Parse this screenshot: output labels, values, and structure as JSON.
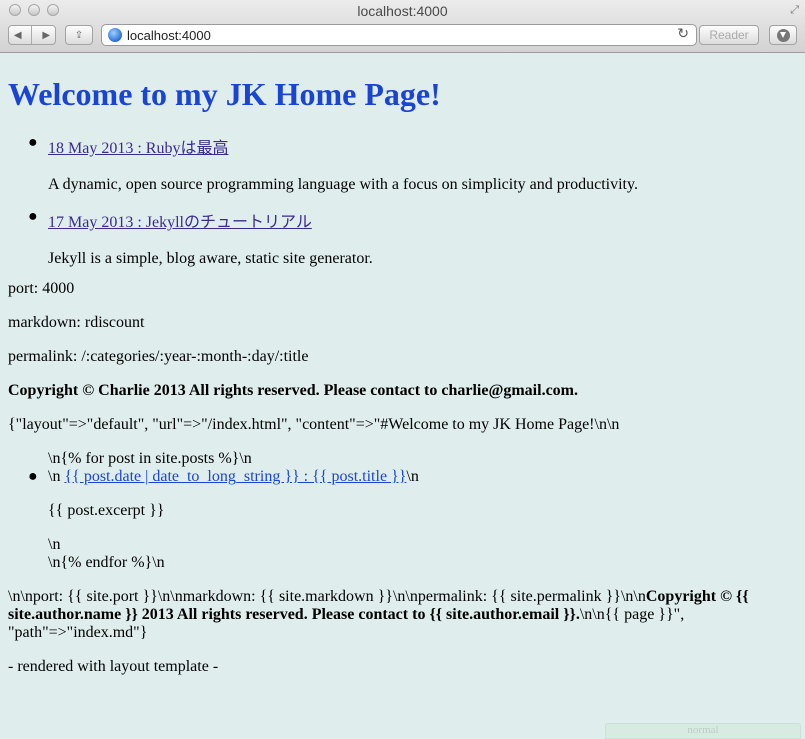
{
  "window": {
    "title": "localhost:4000",
    "url": "localhost:4000",
    "reader_label": "Reader"
  },
  "page": {
    "heading": "Welcome to my JK Home Page!",
    "posts": [
      {
        "link": "18 May 2013 : Rubyは最高",
        "excerpt": "A dynamic, open source programming language with a focus on simplicity and productivity."
      },
      {
        "link": "17 May 2013 : Jekyllのチュートリアル",
        "excerpt": "Jekyll is a simple, blog aware, static site generator."
      }
    ],
    "port_line": "port: 4000",
    "markdown_line": "markdown: rdiscount",
    "permalink_line": "permalink: /:categories/:year-:month-:day/:title",
    "copyright_line": "Copyright © Charlie 2013 All rights reserved. Please contact to charlie@gmail.com.",
    "raw_dump_start": "{\"layout\"=>\"default\", \"url\"=>\"/index.html\", \"content\"=>\"#Welcome to my JK Home Page!\\n\\n",
    "raw_for": "\\n{% for post in site.posts %}\\n",
    "raw_item_prefix": "\\n ",
    "raw_item_link": "{{ post.date | date_to_long_string }} : {{ post.title }}",
    "raw_item_suffix": "\\n",
    "raw_excerpt": "{{ post.excerpt }}",
    "raw_newline": "\\n",
    "raw_endfor": "\\n{% endfor %}\\n",
    "raw_tail_1": "\\n\\nport: {{ site.port }}\\n\\nmarkdown: {{ site.markdown }}\\n\\npermalink: {{ site.permalink }}\\n\\n",
    "raw_tail_bold_1": "Copyright © {{ site.author.name }} 2013 All rights reserved. Please contact to {{ site.author.email }}.",
    "raw_tail_2": "\\n\\n{{ page }}\", \"path\"=>\"index.md\"}",
    "footer_note": "- rendered with layout template -",
    "status_text": "normal"
  }
}
